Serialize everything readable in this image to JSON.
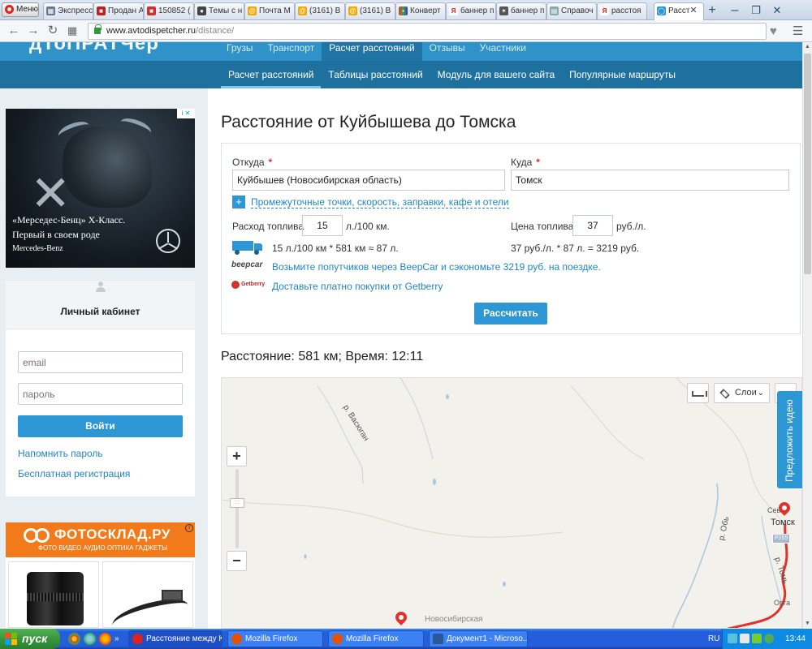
{
  "browser": {
    "menu_label": "Меню",
    "tabs": [
      {
        "label": "Экспресс"
      },
      {
        "label": "Продан А"
      },
      {
        "label": "150852 ("
      },
      {
        "label": "Темы с н"
      },
      {
        "label": "Почта M"
      },
      {
        "label": "(3161) В"
      },
      {
        "label": "(3161) В"
      },
      {
        "label": "Конверт"
      },
      {
        "label": "баннер п"
      },
      {
        "label": "баннер п"
      },
      {
        "label": "Справоч"
      },
      {
        "label": "расстоя"
      },
      {
        "label": "Расст"
      }
    ],
    "url_host": "www.avtodispetcher.ru",
    "url_path": "/distance/"
  },
  "site": {
    "logo": "дТоПРАТЧер",
    "top_nav": [
      "Грузы",
      "Транспорт",
      "Расчет расстояний",
      "Отзывы",
      "Участники"
    ],
    "sub_nav": [
      "Расчет расстояний",
      "Таблицы расстояний",
      "Модуль для вашего сайта",
      "Популярные маршруты"
    ]
  },
  "ad_mercedes": {
    "line1": "«Мерседес-Бенц» X-Класс.",
    "line2": "Первый в своем роде",
    "brand": "Mercedes-Benz"
  },
  "cabinet": {
    "title": "Личный кабинет",
    "email_placeholder": "email",
    "password_placeholder": "пароль",
    "login_button": "Войти",
    "remind_link": "Напомнить пароль",
    "register_link": "Бесплатная регистрация"
  },
  "ad_fotosklad": {
    "brand": "ФОТОСКЛАД.РУ",
    "tagline": "ФОТО ВИДЕО АУДИО ОПТИКА ГАДЖЕТЫ"
  },
  "main": {
    "title": "Расстояние от Куйбышева до Томска",
    "from_label": "Откуда",
    "from_value": "Куйбышев (Новосибирская область)",
    "to_label": "Куда",
    "to_value": "Томск",
    "options_link": "Промежуточные точки, скорость, заправки, кафе и отели",
    "fuel_label": "Расход топлива",
    "fuel_value": "15",
    "fuel_unit": "л./100 км.",
    "price_label": "Цена топлива",
    "price_value": "37",
    "price_unit": "руб./л.",
    "fuel_calc": "15 л./100 км * 581 км ≈ 87 л.",
    "price_calc": "37 руб./л. * 87 л. = 3219 руб.",
    "beepcar_logo": "beepcar",
    "beepcar_text": "Возьмите попутчиков через BeepCar и сэкономьте 3219 руб. на поездке.",
    "getberry_logo": "Getberry",
    "getberry_text": "Доставьте платно покупки от Getberry",
    "calc_button": "Рассчитать",
    "result": "Расстояние: 581 км; Время: 12:11"
  },
  "map": {
    "layers_label": "Слои",
    "labels": {
      "river_vasyugan": "р. Васюган",
      "river_ob": "р. Обь",
      "river_tom": "р. Томь",
      "sev": "Сев",
      "tomsk": "Томск",
      "orga": "Орга",
      "novosibirsk": "Новосибирская",
      "road": "Р255"
    }
  },
  "idea_tab": "Предложить идею",
  "taskbar": {
    "start": "пуск",
    "tasks": [
      "Расстояние между К...",
      "Mozilla Firefox",
      "Mozilla Firefox",
      "Документ1 - Microso..."
    ],
    "lang": "RU",
    "clock": "13:44"
  },
  "colors": {
    "brand_blue": "#2f92c9",
    "dark_blue": "#1e709f",
    "button_blue": "#2d96d4",
    "required_red": "#e0322c",
    "route_red": "#e2322a"
  }
}
